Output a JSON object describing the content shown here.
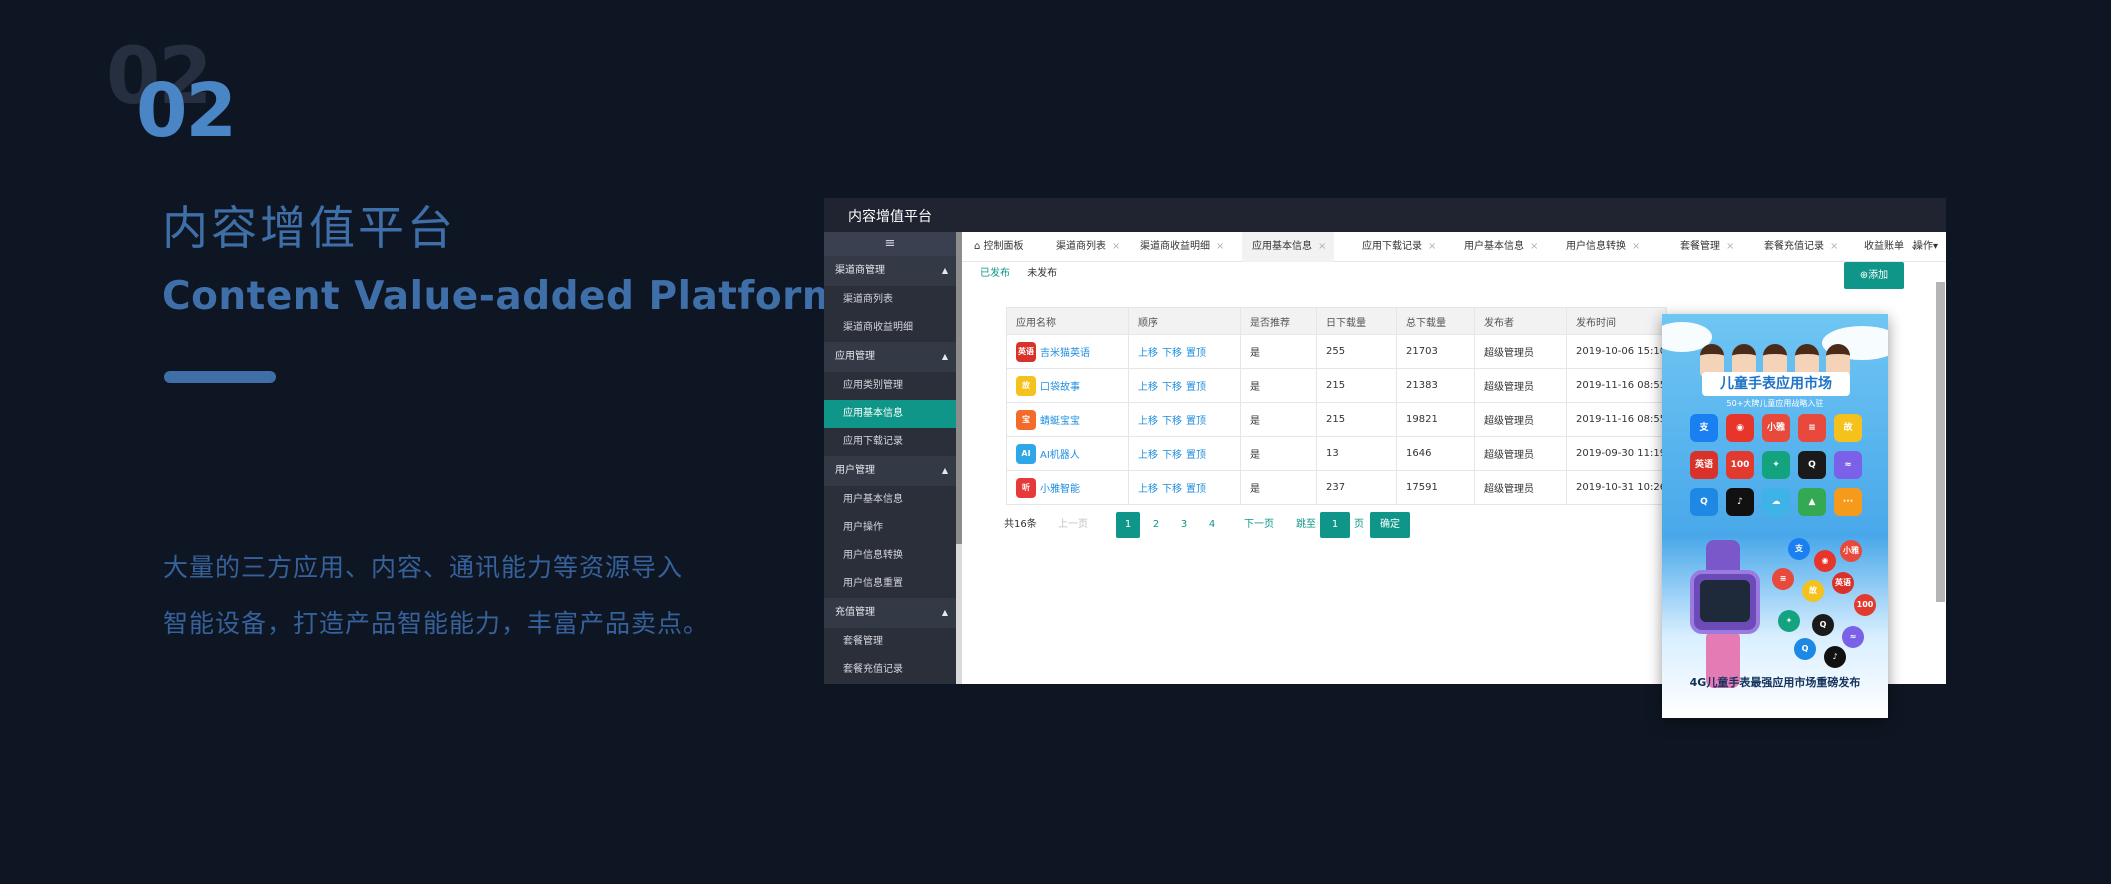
{
  "hero": {
    "ghost_number": "02",
    "number": "02",
    "title_cn": "内容增值平台",
    "title_en": "Content Value-added Platform",
    "desc_line1": "大量的三方应用、内容、通讯能力等资源导入",
    "desc_line2": "智能设备，打造产品智能能力，丰富产品卖点。"
  },
  "window": {
    "title": "内容增值平台",
    "menu_toggle": "≡"
  },
  "sidebar": {
    "groups": [
      {
        "label": "渠道商管理",
        "items": [
          "渠道商列表",
          "渠道商收益明细"
        ]
      },
      {
        "label": "应用管理",
        "items": [
          "应用类别管理",
          "应用基本信息",
          "应用下载记录"
        ]
      },
      {
        "label": "用户管理",
        "items": [
          "用户基本信息",
          "用户操作",
          "用户信息转换",
          "用户信息重置"
        ]
      },
      {
        "label": "充值管理",
        "items": [
          "套餐管理",
          "套餐充值记录"
        ]
      }
    ],
    "active_item": "应用基本信息"
  },
  "tabs": {
    "items": [
      "控制面板",
      "渠道商列表",
      "渠道商收益明细",
      "应用基本信息",
      "应用下载记录",
      "用户基本信息",
      "用户信息转换",
      "套餐管理",
      "套餐充值记录",
      "收益账单"
    ],
    "close": "×",
    "operation": "操作▾",
    "chevron": "⌄"
  },
  "subtabs": {
    "published": "已发布",
    "unpublished": "未发布"
  },
  "add_button": "⊕添加",
  "table": {
    "headers": [
      "应用名称",
      "顺序",
      "是否推荐",
      "日下载量",
      "总下载量",
      "发布者",
      "发布时间"
    ],
    "ops": [
      "上移",
      "下移",
      "置顶"
    ],
    "rows": [
      {
        "name": "吉米猫英语",
        "recommended": "是",
        "daily": "255",
        "total": "21703",
        "publisher": "超级管理员",
        "time": "2019-10-06 15:10",
        "icon_text": "英语",
        "icon_color": "#d9322b"
      },
      {
        "name": "口袋故事",
        "recommended": "是",
        "daily": "215",
        "total": "21383",
        "publisher": "超级管理员",
        "time": "2019-11-16 08:55",
        "icon_text": "故",
        "icon_color": "#f5c11c"
      },
      {
        "name": "蜻蜓宝宝",
        "recommended": "是",
        "daily": "215",
        "total": "19821",
        "publisher": "超级管理员",
        "time": "2019-11-16 08:55",
        "icon_text": "宝",
        "icon_color": "#f26b2b"
      },
      {
        "name": "AI机器人",
        "recommended": "是",
        "daily": "13",
        "total": "1646",
        "publisher": "超级管理员",
        "time": "2019-09-30 11:19",
        "icon_text": "AI",
        "icon_color": "#2ea7e8"
      },
      {
        "name": "小雅智能",
        "recommended": "是",
        "daily": "237",
        "total": "17591",
        "publisher": "超级管理员",
        "time": "2019-10-31 10:26",
        "icon_text": "听",
        "icon_color": "#e63a3a"
      }
    ]
  },
  "pager": {
    "total": "共16条",
    "prev": "上一页",
    "pages": [
      "1",
      "2",
      "3",
      "4"
    ],
    "next": "下一页",
    "goto": "跳至",
    "goto_value": "1",
    "unit": "页",
    "confirm": "确定"
  },
  "phone": {
    "title": "儿童手表应用市场",
    "subtitle": "50+大牌儿童应用战略入驻",
    "grid": [
      {
        "t": "支",
        "c": "#1a7ff0"
      },
      {
        "t": "◉",
        "c": "#e7352c"
      },
      {
        "t": "小雅",
        "c": "#e74a3c"
      },
      {
        "t": "≡",
        "c": "#e74a3c"
      },
      {
        "t": "故",
        "c": "#f5c11c"
      },
      {
        "t": "英语",
        "c": "#d9322b"
      },
      {
        "t": "100",
        "c": "#e23a2f"
      },
      {
        "t": "✦",
        "c": "#14a37f"
      },
      {
        "t": "Q",
        "c": "#1a1a1a"
      },
      {
        "t": "≈",
        "c": "#7b61e8"
      },
      {
        "t": "Q",
        "c": "#1e88e5"
      },
      {
        "t": "♪",
        "c": "#111111"
      },
      {
        "t": "☁",
        "c": "#3fb3e8"
      },
      {
        "t": "▲",
        "c": "#34a853"
      },
      {
        "t": "···",
        "c": "#f59a1b"
      }
    ],
    "footer": "4G儿童手表最强应用市场重磅发布"
  }
}
